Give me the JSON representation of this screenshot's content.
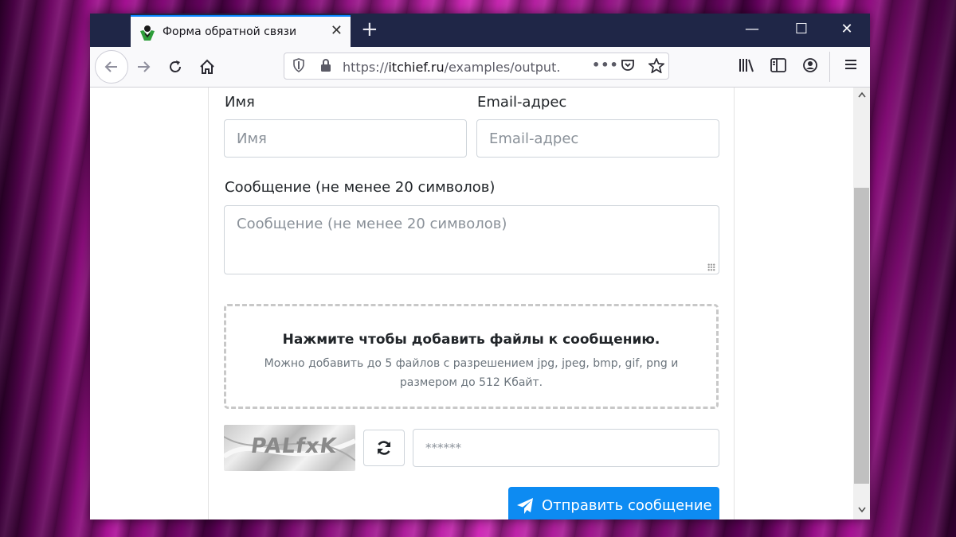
{
  "browser": {
    "tab_title": "Форма обратной связи",
    "tab_close": "✕",
    "new_tab": "+",
    "url_prefix": "https://",
    "url_domain": "itchief.ru",
    "url_path": "/examples/output.p",
    "window_controls": {
      "minimize": "—",
      "maximize": "☐",
      "close": "✕"
    },
    "page_actions": "•••"
  },
  "form": {
    "name_label": "Имя",
    "name_placeholder": "Имя",
    "email_label": "Email-адрес",
    "email_placeholder": "Email-адрес",
    "message_label": "Сообщение (не менее 20 символов)",
    "message_placeholder": "Сообщение (не менее 20 символов)",
    "dropzone_title": "Нажмите чтобы добавить файлы к сообщению.",
    "dropzone_subtitle": "Можно добавить до 5 файлов с разрешением jpg, jpeg, bmp, gif, png и размером до 512 Кбайт.",
    "captcha_text": "PALfxK",
    "captcha_placeholder": "******",
    "submit_label": "Отправить сообщение"
  },
  "colors": {
    "accent": "#0d8bf2",
    "tabbar": "#1f2647",
    "tab_highlight": "#0a84ff"
  }
}
